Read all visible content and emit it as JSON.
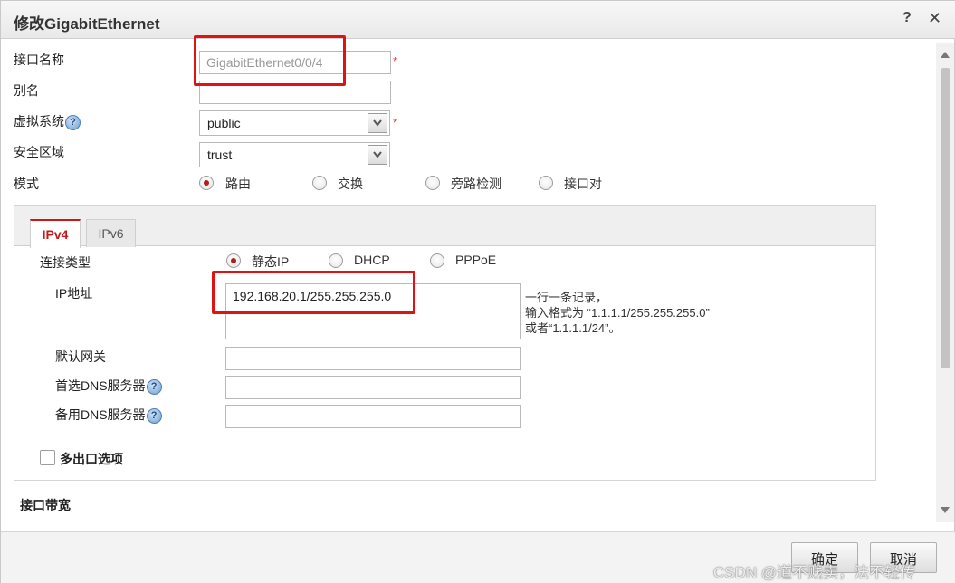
{
  "dialog": {
    "title": "修改GigabitEthernet",
    "help_label": "?",
    "close_label": "✕"
  },
  "form": {
    "interface_name_label": "接口名称",
    "interface_name_value": "GigabitEthernet0/0/4",
    "required_mark": "*",
    "alias_label": "别名",
    "alias_value": "",
    "vsys_label": "虚拟系统",
    "vsys_value": "public",
    "zone_label": "安全区域",
    "zone_value": "trust",
    "mode_label": "模式",
    "mode_options": [
      "路由",
      "交换",
      "旁路检测",
      "接口对"
    ],
    "mode_selected": "路由"
  },
  "tabs": [
    "IPv4",
    "IPv6"
  ],
  "ipv4": {
    "conn_type_label": "连接类型",
    "conn_options": [
      "静态IP",
      "DHCP",
      "PPPoE"
    ],
    "conn_selected": "静态IP",
    "ip_label": "IP地址",
    "ip_value": "192.168.20.1/255.255.255.0",
    "hint_lines": [
      "一行一条记录，",
      "输入格式为 “1.1.1.1/255.255.255.0”",
      "或者“1.1.1.1/24”。"
    ],
    "gateway_label": "默认网关",
    "gateway_value": "",
    "dns1_label": "首选DNS服务器",
    "dns1_value": "",
    "dns2_label": "备用DNS服务器",
    "dns2_value": "",
    "multi_exit_label": "多出口选项",
    "help_glyph": "?"
  },
  "bandwidth_label": "接口带宽",
  "footer": {
    "ok_label": "确定",
    "cancel_label": "取消"
  },
  "watermark": "CSDN @道不贱卖，法不轻传",
  "colors": {
    "accent_red": "#c41a1a",
    "highlight_box": "#e01212"
  }
}
